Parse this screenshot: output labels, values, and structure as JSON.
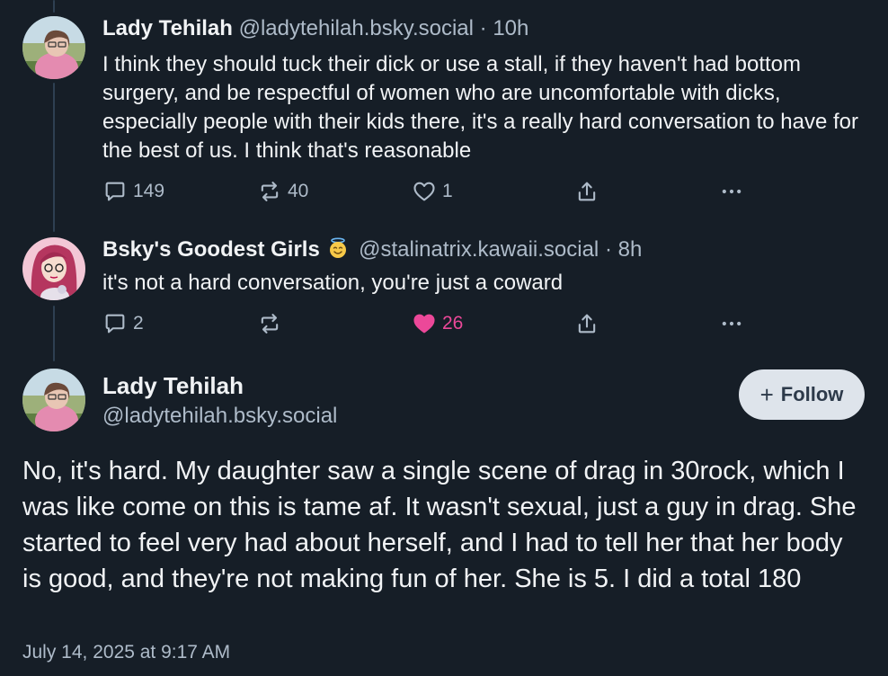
{
  "reply1": {
    "display_name": "Lady Tehilah",
    "handle": "@ladytehilah.bsky.social",
    "separator": "·",
    "time": "10h",
    "text": "I think they should tuck their dick or use a stall, if they haven't had bottom surgery, and be respectful of women who are uncomfortable with dicks, especially people with their kids there, it's a really hard conversation to have for the best of us. I think that's reasonable",
    "replies": "149",
    "reposts": "40",
    "likes": "1"
  },
  "reply2": {
    "display_name": "Bsky's Goodest Girls",
    "emoji": "smiling-face-with-halo",
    "handle": "@stalinatrix.kawaii.social",
    "separator": "·",
    "time": "8h",
    "text": "it's not a hard conversation, you're just a coward",
    "replies": "2",
    "reposts": "",
    "likes": "26",
    "liked": true
  },
  "main_post": {
    "display_name": "Lady Tehilah",
    "handle": "@ladytehilah.bsky.social",
    "follow_label": "Follow",
    "text": "No, it's hard. My daughter saw a single scene of drag in 30rock, which I was like come on this is tame af. It wasn't sexual, just a guy in drag. She started to feel very had about herself, and I had to tell her that her body is good, and they're not making fun of her. She is 5. I did a total 180",
    "date": "July 14, 2025 at 9:17 AM"
  },
  "colors": {
    "background": "#161e27",
    "text": "#f1f3f5",
    "muted": "#aebbc9",
    "like_active": "#ec4899",
    "follow_button_bg": "#dee4eb"
  }
}
